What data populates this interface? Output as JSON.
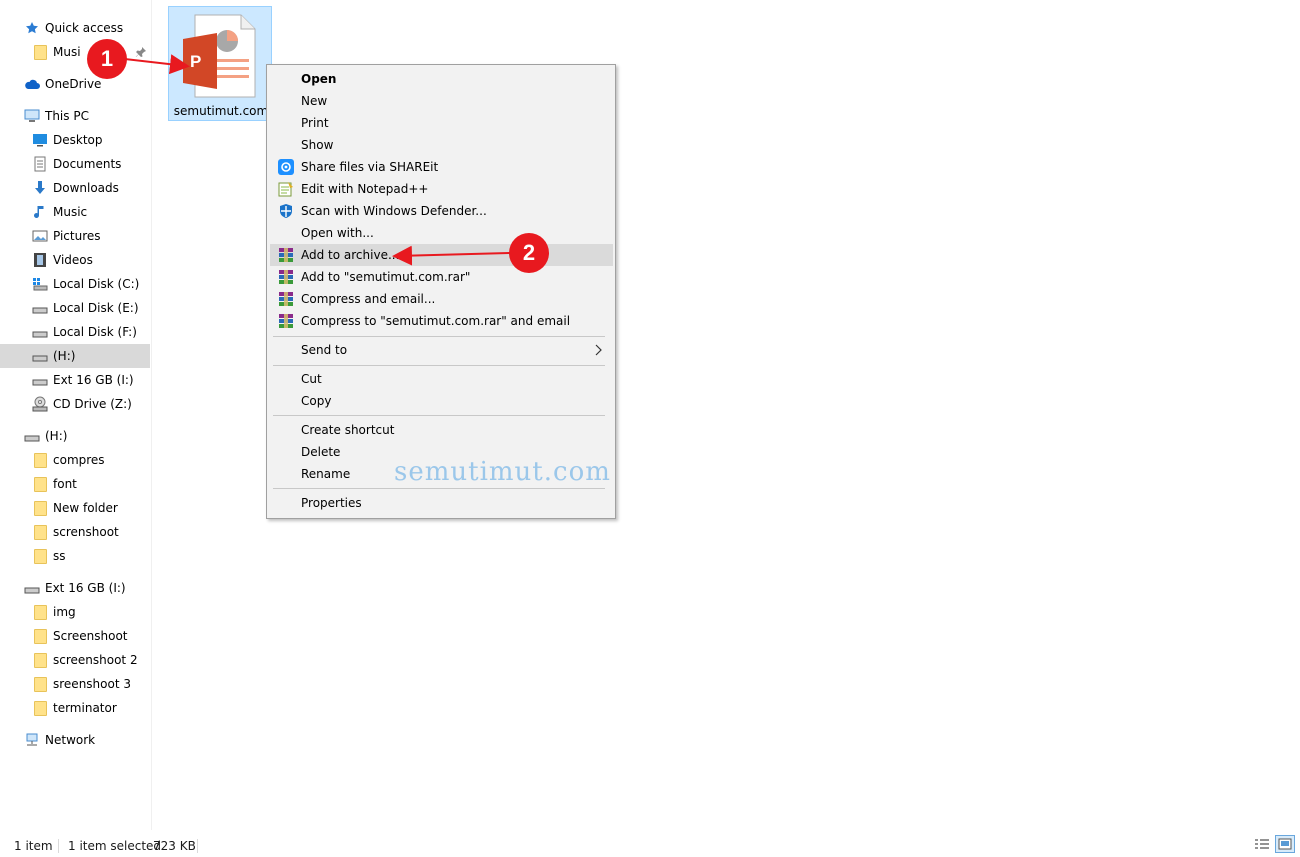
{
  "sidebar": {
    "items": [
      {
        "label": "Quick access",
        "icon": "star-icon"
      },
      {
        "label": "Musi",
        "icon": "folder-icon"
      },
      {
        "label": "OneDrive",
        "icon": "cloud-icon"
      },
      {
        "label": "This PC",
        "icon": "computer-icon"
      },
      {
        "label": "Desktop",
        "icon": "desktop-icon"
      },
      {
        "label": "Documents",
        "icon": "documents-icon"
      },
      {
        "label": "Downloads",
        "icon": "download-arrow-icon"
      },
      {
        "label": "Music",
        "icon": "music-note-icon"
      },
      {
        "label": "Pictures",
        "icon": "pictures-icon"
      },
      {
        "label": "Videos",
        "icon": "film-icon"
      },
      {
        "label": "Local Disk (C:)",
        "icon": "windows-drive-icon"
      },
      {
        "label": "Local Disk (E:)",
        "icon": "drive-icon"
      },
      {
        "label": "Local Disk (F:)",
        "icon": "drive-icon"
      },
      {
        "label": " (H:)",
        "icon": "drive-icon"
      },
      {
        "label": "Ext 16 GB (I:)",
        "icon": "drive-icon"
      },
      {
        "label": "CD Drive (Z:)",
        "icon": "cd-drive-icon"
      },
      {
        "label": " (H:)",
        "icon": "drive-icon"
      },
      {
        "label": "compres",
        "icon": "folder-icon"
      },
      {
        "label": "font",
        "icon": "folder-icon"
      },
      {
        "label": "New folder",
        "icon": "folder-icon"
      },
      {
        "label": "screnshoot",
        "icon": "folder-icon"
      },
      {
        "label": "ss",
        "icon": "folder-icon"
      },
      {
        "label": "Ext 16 GB (I:)",
        "icon": "drive-icon"
      },
      {
        "label": "img",
        "icon": "folder-icon"
      },
      {
        "label": "Screenshoot",
        "icon": "folder-icon"
      },
      {
        "label": "screenshoot 2",
        "icon": "folder-icon"
      },
      {
        "label": "sreenshoot 3",
        "icon": "folder-icon"
      },
      {
        "label": "terminator",
        "icon": "folder-icon"
      },
      {
        "label": "Network",
        "icon": "network-icon"
      }
    ]
  },
  "file": {
    "name": "semutimut.com",
    "icon": "powerpoint-file-icon",
    "icon_letter": "P"
  },
  "context_menu": {
    "items": [
      {
        "label": "Open",
        "bold": true,
        "icon": ""
      },
      {
        "label": "New",
        "icon": ""
      },
      {
        "label": "Print",
        "icon": ""
      },
      {
        "label": "Show",
        "icon": ""
      },
      {
        "label": "Share files via SHAREit",
        "icon": "shareit-icon"
      },
      {
        "label": "Edit with Notepad++",
        "icon": "notepad-plus-plus-icon"
      },
      {
        "label": "Scan with Windows Defender...",
        "icon": "windows-defender-icon"
      },
      {
        "label": "Open with...",
        "icon": ""
      },
      {
        "label": "Add to archive...",
        "icon": "winrar-icon",
        "highlighted": true
      },
      {
        "label": "Add to \"semutimut.com.rar\"",
        "icon": "winrar-icon"
      },
      {
        "label": "Compress and email...",
        "icon": "winrar-icon"
      },
      {
        "label": "Compress to \"semutimut.com.rar\" and email",
        "icon": "winrar-icon"
      },
      {
        "label": "Send to",
        "icon": "",
        "submenu": true
      },
      {
        "label": "Cut",
        "icon": ""
      },
      {
        "label": "Copy",
        "icon": ""
      },
      {
        "label": "Create shortcut",
        "icon": ""
      },
      {
        "label": "Delete",
        "icon": ""
      },
      {
        "label": "Rename",
        "icon": ""
      },
      {
        "label": "Properties",
        "icon": ""
      }
    ],
    "watermark": "semutimut.com"
  },
  "annotations": {
    "step1": "1",
    "step2": "2",
    "color": "#e8191f"
  },
  "status_bar": {
    "item_count": "1 item",
    "selected": "1 item selected",
    "size": "723 KB"
  },
  "colors": {
    "selection_bg": "#cce8ff",
    "menu_bg": "#f2f2f2",
    "menu_highlight": "#dadada",
    "nav_selected": "#d9d9d9",
    "powerpoint": "#d24726"
  }
}
